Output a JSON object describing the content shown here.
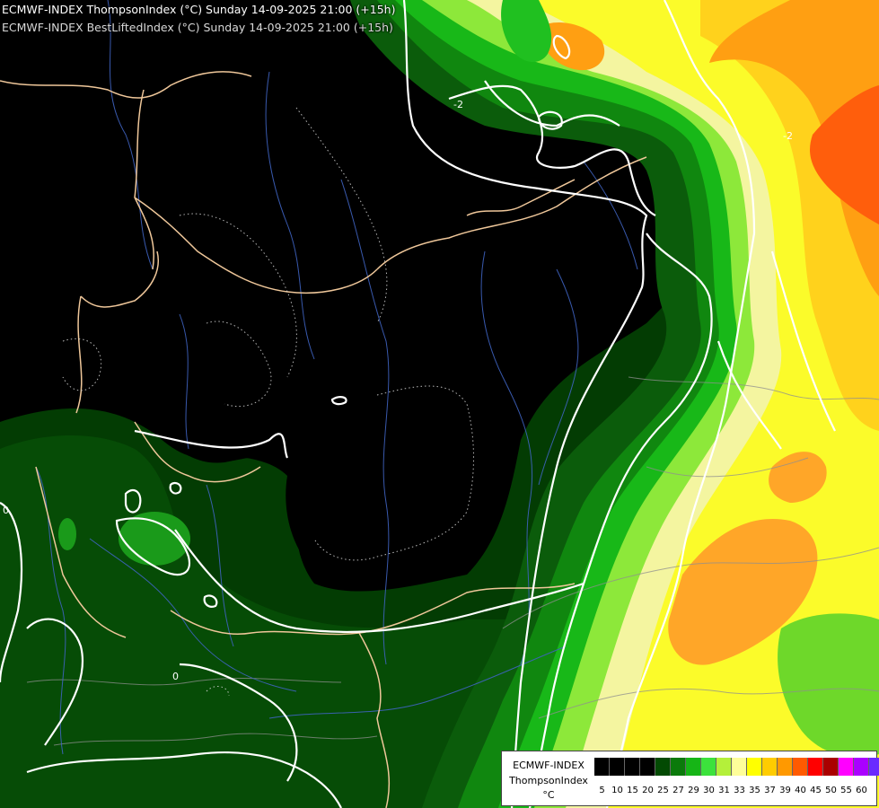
{
  "header": {
    "line1": "ECMWF-INDEX ThompsonIndex (°C) Sunday 14-09-2025 21:00 (+15h)",
    "line2": "ECMWF-INDEX BestLiftedIndex (°C) Sunday 14-09-2025 21:00 (+15h)"
  },
  "legend": {
    "model": "ECMWF-INDEX",
    "parameter": "ThompsonIndex",
    "unit": "°C",
    "bins": [
      {
        "label": "5",
        "color": "#000000"
      },
      {
        "label": "10",
        "color": "#000000"
      },
      {
        "label": "15",
        "color": "#000000"
      },
      {
        "label": "20",
        "color": "#000000"
      },
      {
        "label": "25",
        "color": "#034a03"
      },
      {
        "label": "27",
        "color": "#0b7a0b"
      },
      {
        "label": "29",
        "color": "#16b516"
      },
      {
        "label": "30",
        "color": "#3ce23c"
      },
      {
        "label": "31",
        "color": "#b4f03a"
      },
      {
        "label": "33",
        "color": "#fefe9a"
      },
      {
        "label": "35",
        "color": "#ffff00"
      },
      {
        "label": "37",
        "color": "#ffcc00"
      },
      {
        "label": "39",
        "color": "#ff9900"
      },
      {
        "label": "40",
        "color": "#ff5a00"
      },
      {
        "label": "45",
        "color": "#ff0000"
      },
      {
        "label": "50",
        "color": "#aa0000"
      },
      {
        "label": "55",
        "color": "#ff00ff"
      },
      {
        "label": "60",
        "color": "#aa00ff"
      },
      {
        "label": "",
        "color": "#6a2aff"
      },
      {
        "label": "",
        "color": "#0000ff"
      }
    ]
  },
  "map_labels": [
    {
      "text": "-2"
    },
    {
      "text": "-2"
    },
    {
      "text": "0"
    },
    {
      "text": "0"
    }
  ],
  "colors": {
    "country_border": "#f0c8a0",
    "rivers": "#4a6fc8",
    "region_lines": "#9a9a9a",
    "contour_solid": "#ffffff"
  }
}
